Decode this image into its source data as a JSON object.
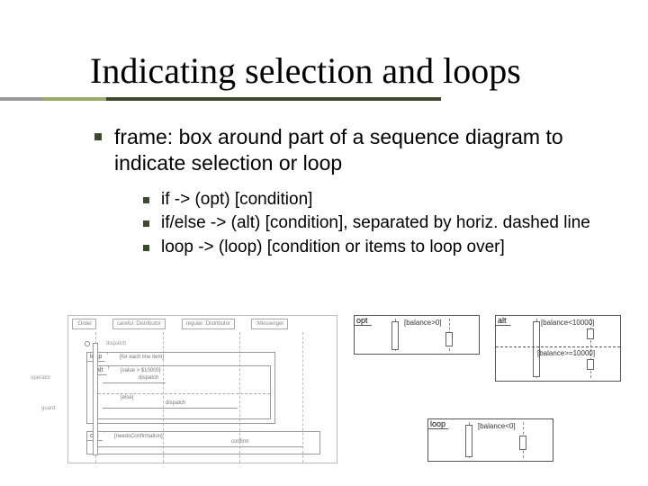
{
  "title": "Indicating selection and loops",
  "bullet_main": "frame: box around part of a sequence diagram to indicate selection or loop",
  "sub": {
    "a": "if -> (opt) [condition]",
    "b": "if/else -> (alt) [condition], separated by horiz. dashed line",
    "c": "loop -> (loop) [condition or items to loop over]"
  },
  "left_diagram": {
    "headers": {
      "a": ":Order",
      "b": "careful :Distributor",
      "c": "regular :Distributor",
      "d": ":Messenger"
    },
    "loop_tag": "loop",
    "loop_guard": "[for each line item]",
    "alt_tag": "alt",
    "alt_guard_top": "[value > $10000]",
    "alt_guard_bot": "[else]",
    "msg_dispatch": "dispatch",
    "opt_tag": "opt",
    "opt_guard": "[needsConfirmation]",
    "msg_confirm": "confirm",
    "label_operator": "operator",
    "label_guard": "guard"
  },
  "opt_diagram": {
    "tag": "opt",
    "guard": "[balance>0]"
  },
  "alt_diagram": {
    "tag": "alt",
    "guard_top": "[balance<10000]",
    "guard_bot": "[balance>=10000]"
  },
  "loop_diagram": {
    "tag": "loop",
    "guard": "[balance<0]"
  }
}
